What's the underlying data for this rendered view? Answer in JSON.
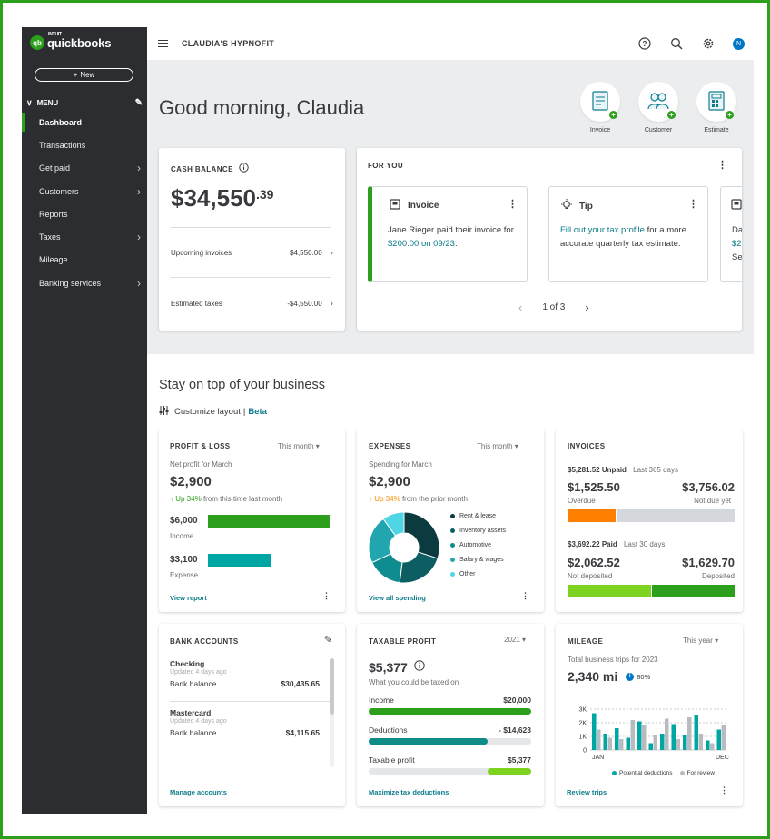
{
  "app": {
    "brand_intuit": "INTUIT",
    "brand": "quickbooks",
    "new_label": "New",
    "company": "CLAUDIA'S HYPNOFIT"
  },
  "sidebar": {
    "menu_label": "MENU",
    "items": [
      {
        "label": "Dashboard",
        "active": true,
        "arrow": false
      },
      {
        "label": "Transactions",
        "arrow": false
      },
      {
        "label": "Get paid",
        "arrow": true
      },
      {
        "label": "Customers",
        "arrow": true
      },
      {
        "label": "Reports",
        "arrow": false
      },
      {
        "label": "Taxes",
        "arrow": true
      },
      {
        "label": "Mileage",
        "arrow": false
      },
      {
        "label": "Banking services",
        "arrow": true
      }
    ]
  },
  "topbar": {
    "avatar_initial": "N"
  },
  "hero": {
    "greeting": "Good morning, Claudia",
    "quick_actions": [
      {
        "label": "Invoice",
        "icon": "invoice-icon"
      },
      {
        "label": "Customer",
        "icon": "customer-icon"
      },
      {
        "label": "Estimate",
        "icon": "estimate-icon"
      }
    ]
  },
  "cash_balance": {
    "title": "CASH BALANCE",
    "amount_main": "$34,550",
    "amount_cents": ".39",
    "rows": [
      {
        "label": "Upcoming invoices",
        "value": "$4,550.00"
      },
      {
        "label": "Estimated taxes",
        "value": "-$4,550.00"
      }
    ]
  },
  "for_you": {
    "title": "FOR YOU",
    "invoice_card": {
      "title": "Invoice",
      "text": "Jane Rieger paid their invoice for ",
      "link": "$200.00 on 09/23",
      "end": "."
    },
    "tip_card": {
      "title": "Tip",
      "link": "Fill out your tax profile",
      "text": " for a more accurate quarterly tax estimate."
    },
    "third_card": {
      "l1": "Da",
      "l2": "$2",
      "l3": "Se"
    },
    "pager": "1 of 3"
  },
  "section": {
    "title": "Stay on top of your business",
    "customize": "Customize layout",
    "sep": "|",
    "beta": "Beta"
  },
  "profit_loss": {
    "title": "PROFIT & LOSS",
    "period": "This month",
    "subtitle": "Net profit for March",
    "amount": "$2,900",
    "change": "Up 34%",
    "change_text": "from this time last month",
    "income_value": "$6,000",
    "income_label": "Income",
    "income_fraction": 1.0,
    "expense_value": "$3,100",
    "expense_label": "Expense",
    "expense_fraction": 0.52,
    "link": "View report"
  },
  "expenses": {
    "title": "EXPENSES",
    "period": "This month",
    "subtitle": "Spending for March",
    "amount": "$2,900",
    "change": "Up 34%",
    "change_text": "from the prior month",
    "categories": [
      {
        "name": "Rent & lease",
        "color": "#0b3a3f",
        "share": 0.3
      },
      {
        "name": "Inventory assets",
        "color": "#0c5e63",
        "share": 0.22
      },
      {
        "name": "Automotive",
        "color": "#0e8c8f",
        "share": 0.16
      },
      {
        "name": "Salary & wages",
        "color": "#21a6b0",
        "share": 0.22
      },
      {
        "name": "Other",
        "color": "#4fd6e5",
        "share": 0.1
      }
    ],
    "link": "View all spending"
  },
  "invoices": {
    "title": "INVOICES",
    "unpaid_amount": "$5,281.52 Unpaid",
    "unpaid_period": "Last 365 days",
    "overdue_value": "$1,525.50",
    "overdue_label": "Overdue",
    "notdue_value": "$3,756.02",
    "notdue_label": "Not due yet",
    "overdue_fraction": 0.29,
    "paid_amount": "$3,692.22 Paid",
    "paid_period": "Last 30 days",
    "notdep_value": "$2,062.52",
    "notdep_label": "Not deposited",
    "dep_value": "$1,629.70",
    "dep_label": "Deposited",
    "notdep_fraction": 0.5
  },
  "bank_accounts": {
    "title": "BANK ACCOUNTS",
    "accounts": [
      {
        "name": "Checking",
        "updated": "Updated 4 days ago",
        "label": "Bank balance",
        "value": "$30,435.65"
      },
      {
        "name": "Mastercard",
        "updated": "Updated 4 days ago",
        "label": "Bank balance",
        "value": "$4,115.65"
      }
    ],
    "link": "Manage accounts"
  },
  "taxable_profit": {
    "title": "TAXABLE PROFIT",
    "year": "2021",
    "amount": "$5,377",
    "subtitle": "What you could be taxed on",
    "rows": [
      {
        "label": "Income",
        "value": "$20,000",
        "fraction": 1.0,
        "color": "#2ca01c"
      },
      {
        "label": "Deductions",
        "value": "- $14,623",
        "fraction": 0.73,
        "color": "#0d8c88"
      },
      {
        "label": "Taxable profit",
        "value": "$5,377",
        "fraction": 0.27,
        "color": "#7ed321"
      }
    ],
    "link": "Maximize tax deductions"
  },
  "mileage": {
    "title": "MILEAGE",
    "period": "This year",
    "subtitle": "Total business trips for 2023",
    "amount": "2,340 mi",
    "badge": "80%",
    "chart_data": {
      "type": "bar",
      "y_ticks": [
        "3K",
        "2K",
        "1K",
        "0"
      ],
      "x_labels": [
        "JAN",
        "DEC"
      ],
      "ylim": [
        0,
        3000
      ],
      "series": [
        {
          "name": "Potential deductions",
          "color": "#00a6a4",
          "values": [
            2700,
            1200,
            1600,
            900,
            2100,
            500,
            1200,
            1900,
            1100,
            2600,
            700,
            1500
          ]
        },
        {
          "name": "For review",
          "color": "#b8bcc1",
          "values": [
            1500,
            900,
            800,
            2200,
            1800,
            1100,
            2300,
            800,
            2400,
            1200,
            500,
            1800
          ]
        }
      ]
    },
    "link": "Review trips"
  }
}
